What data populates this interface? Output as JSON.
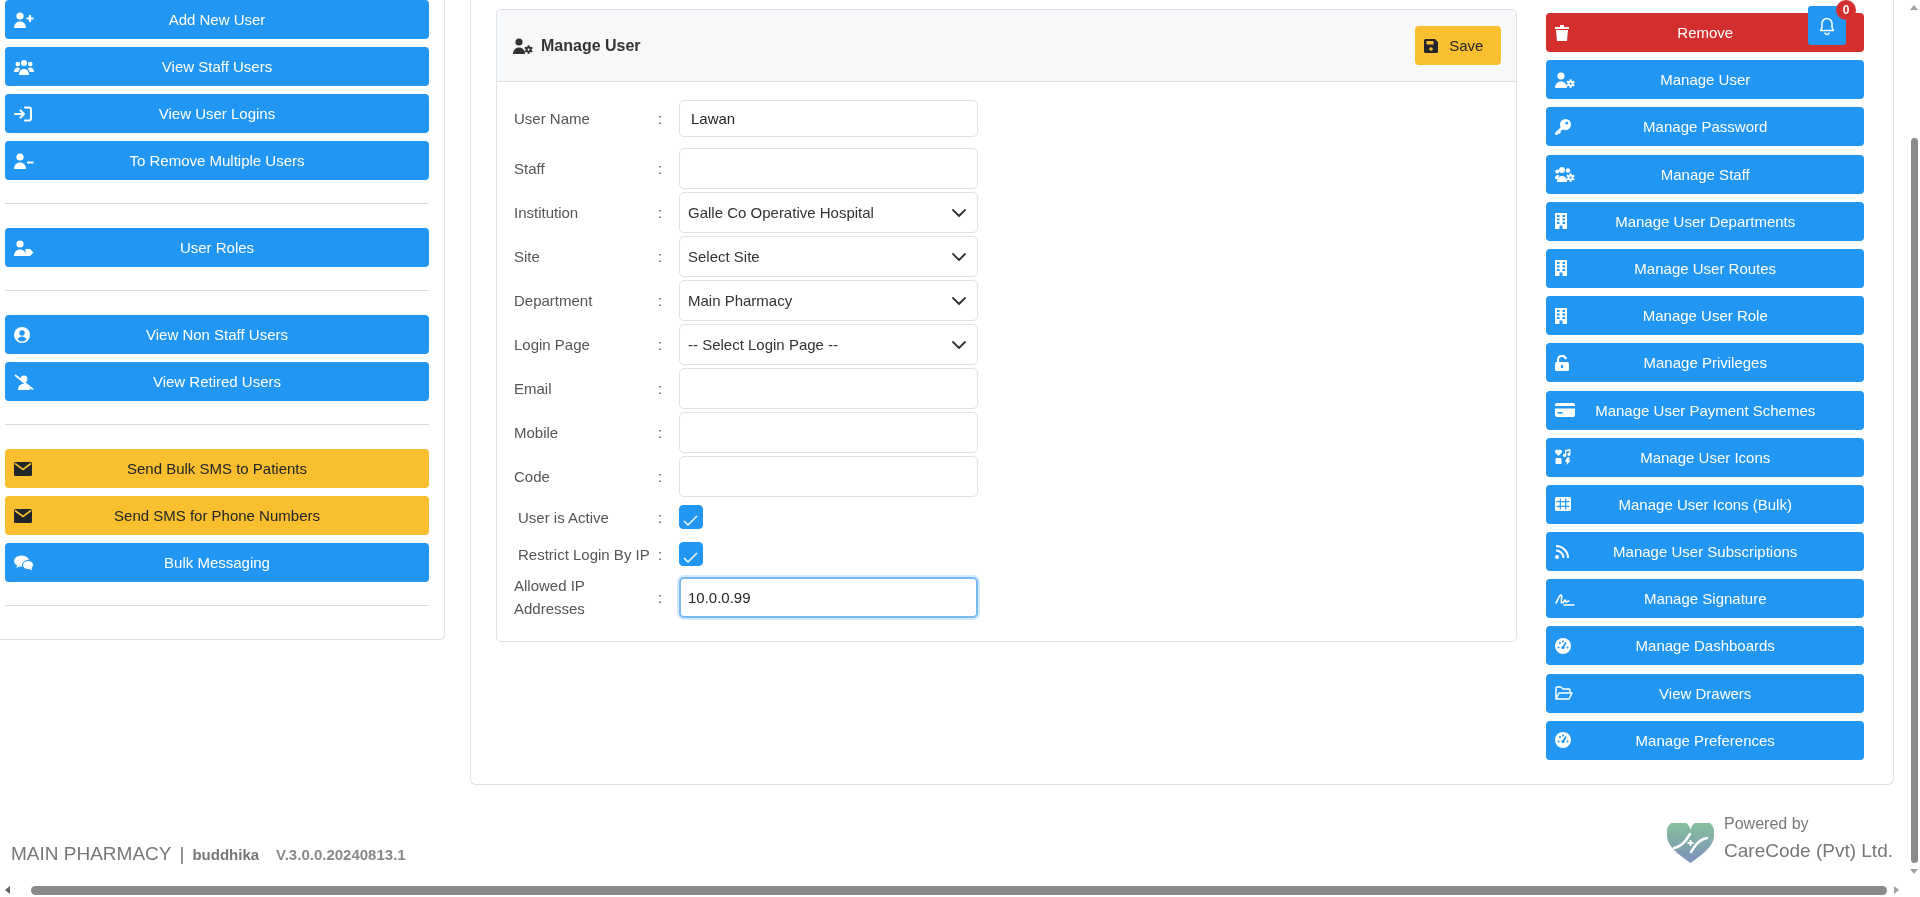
{
  "sidebar": {
    "groups": [
      {
        "buttons": [
          {
            "label": "Add New User",
            "kind": "primary"
          },
          {
            "label": "View Staff Users",
            "kind": "primary"
          },
          {
            "label": "View User Logins",
            "kind": "primary"
          },
          {
            "label": "To Remove Multiple Users",
            "kind": "primary"
          }
        ]
      },
      {
        "buttons": [
          {
            "label": "User Roles",
            "kind": "primary"
          }
        ]
      },
      {
        "buttons": [
          {
            "label": "View Non Staff Users",
            "kind": "primary"
          },
          {
            "label": "View Retired Users",
            "kind": "primary"
          }
        ]
      },
      {
        "buttons": [
          {
            "label": "Send Bulk SMS to Patients",
            "kind": "warning"
          },
          {
            "label": "Send SMS for Phone Numbers",
            "kind": "warning"
          },
          {
            "label": "Bulk Messaging",
            "kind": "primary"
          }
        ]
      }
    ]
  },
  "form": {
    "title": "Manage User",
    "save_button": "Save",
    "fields": [
      {
        "kind": "text",
        "label": "User Name",
        "colon": ":",
        "value": "Lawan",
        "focused": false
      },
      {
        "kind": "text",
        "label": "Staff",
        "colon": ":",
        "focused": false
      },
      {
        "kind": "select",
        "label": "Institution",
        "colon": ":",
        "value": "Galle Co Operative Hospital",
        "focused": false
      },
      {
        "kind": "select",
        "label": "Site",
        "colon": ":",
        "value": "Select Site",
        "focused": false
      },
      {
        "kind": "select",
        "label": "Department",
        "colon": ":",
        "value": "Main Pharmacy",
        "focused": false
      },
      {
        "kind": "select",
        "label": "Login Page",
        "colon": ":",
        "value": "-- Select Login Page --",
        "focused": false
      },
      {
        "kind": "text",
        "label": "Email",
        "colon": ":",
        "focused": false
      },
      {
        "kind": "text",
        "label": "Mobile",
        "colon": ":",
        "focused": false
      },
      {
        "kind": "text",
        "label": "Code",
        "colon": ":",
        "focused": false
      },
      {
        "kind": "checkbox",
        "label": "User is Active",
        "colon": ":",
        "checked": true
      },
      {
        "kind": "checkbox",
        "label": "Restrict Login By IP",
        "colon": ":",
        "checked": true
      },
      {
        "kind": "text",
        "label": "Allowed IP Addresses",
        "colon": ":",
        "value": "10.0.0.99",
        "focused": true
      }
    ]
  },
  "actions": [
    {
      "label": "Remove",
      "kind": "danger"
    },
    {
      "label": "Manage User",
      "kind": "primary"
    },
    {
      "label": "Manage Password",
      "kind": "primary"
    },
    {
      "label": "Manage Staff",
      "kind": "primary"
    },
    {
      "label": "Manage User Departments",
      "kind": "primary"
    },
    {
      "label": "Manage User Routes",
      "kind": "primary"
    },
    {
      "label": "Manage User Role",
      "kind": "primary"
    },
    {
      "label": "Manage Privileges",
      "kind": "primary"
    },
    {
      "label": "Manage User Payment Schemes",
      "kind": "primary"
    },
    {
      "label": "Manage User Icons",
      "kind": "primary"
    },
    {
      "label": "Manage User Icons (Bulk)",
      "kind": "primary"
    },
    {
      "label": "Manage User Subscriptions",
      "kind": "primary"
    },
    {
      "label": "Manage Signature",
      "kind": "primary"
    },
    {
      "label": "Manage Dashboards",
      "kind": "primary"
    },
    {
      "label": "View Drawers",
      "kind": "primary"
    },
    {
      "label": "Manage Preferences",
      "kind": "primary"
    }
  ],
  "notifications": {
    "count": "0"
  },
  "footer": {
    "department": "MAIN PHARMACY",
    "separator": "|",
    "user": "buddhika",
    "version": "V.3.0.0.20240813.1",
    "powered_by": "Powered by",
    "company": "CareCode (Pvt) Ltd."
  }
}
